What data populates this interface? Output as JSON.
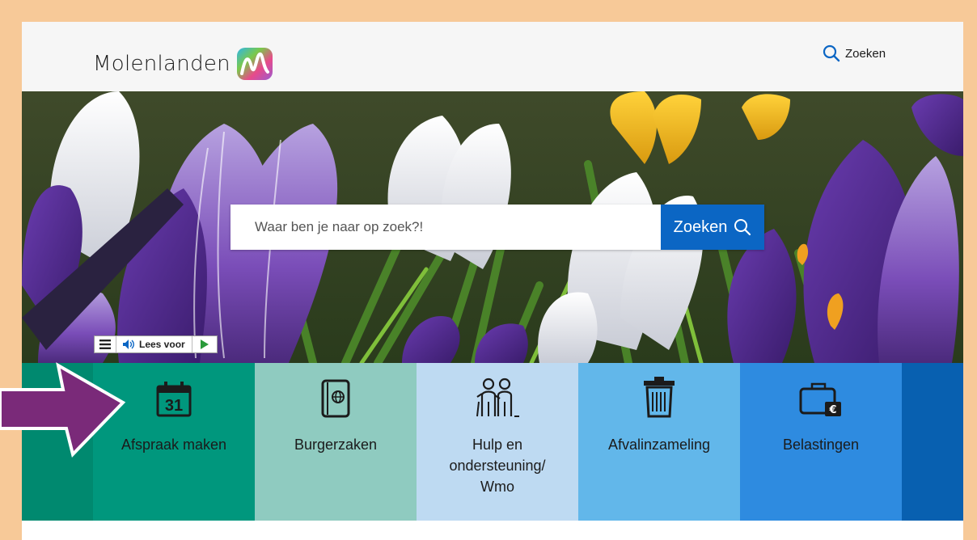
{
  "header": {
    "logo_text": "Molenlanden",
    "search_label": "Zoeken"
  },
  "hero": {
    "search": {
      "placeholder": "Waar ben je naar op zoek?!",
      "button_label": "Zoeken"
    }
  },
  "readspeaker": {
    "label": "Lees voor"
  },
  "tiles": [
    {
      "label": "Afspraak maken",
      "icon": "calendar-icon",
      "calendar_day": "31",
      "color": "#00977d"
    },
    {
      "label": "Burgerzaken",
      "icon": "passport-icon",
      "color": "#8fcbc0"
    },
    {
      "label": "Hulp en ondersteuning/ Wmo",
      "icon": "people-icon",
      "color": "#bedaf2"
    },
    {
      "label": "Afvalinzameling",
      "icon": "trash-icon",
      "color": "#62b7ea"
    },
    {
      "label": "Belastingen",
      "icon": "wallet-euro-icon",
      "color": "#2e8be0"
    }
  ],
  "colors": {
    "frame": "#f7c998",
    "primary_blue": "#0b66c4",
    "tile_left_edge": "#00896f",
    "tile_right_edge": "#0860b0",
    "arrow": "#7a2a79"
  }
}
